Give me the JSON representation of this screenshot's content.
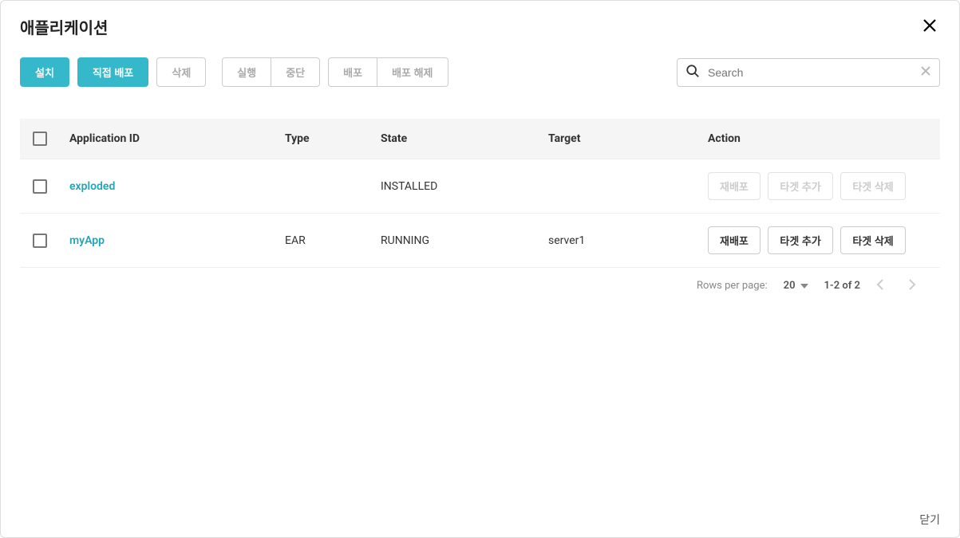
{
  "title": "애플리케이션",
  "toolbar": {
    "install": "설치",
    "direct_deploy": "직접 배포",
    "delete": "삭제",
    "run": "실행",
    "stop": "중단",
    "deploy": "배포",
    "undeploy": "배포 해제"
  },
  "search": {
    "placeholder": "Search"
  },
  "columns": {
    "app_id": "Application ID",
    "type": "Type",
    "state": "State",
    "target": "Target",
    "action": "Action"
  },
  "rows": [
    {
      "id": "exploded",
      "type": "",
      "state": "INSTALLED",
      "target": "",
      "actions_enabled": false
    },
    {
      "id": "myApp",
      "type": "EAR",
      "state": "RUNNING",
      "target": "server1",
      "actions_enabled": true
    }
  ],
  "action_labels": {
    "redeploy": "재배포",
    "add_target": "타겟 추가",
    "delete_target": "타겟 삭제"
  },
  "pagination": {
    "rows_per_page_label": "Rows per page:",
    "rows_per_page_value": "20",
    "range": "1-2 of 2"
  },
  "footer": {
    "close": "닫기"
  }
}
